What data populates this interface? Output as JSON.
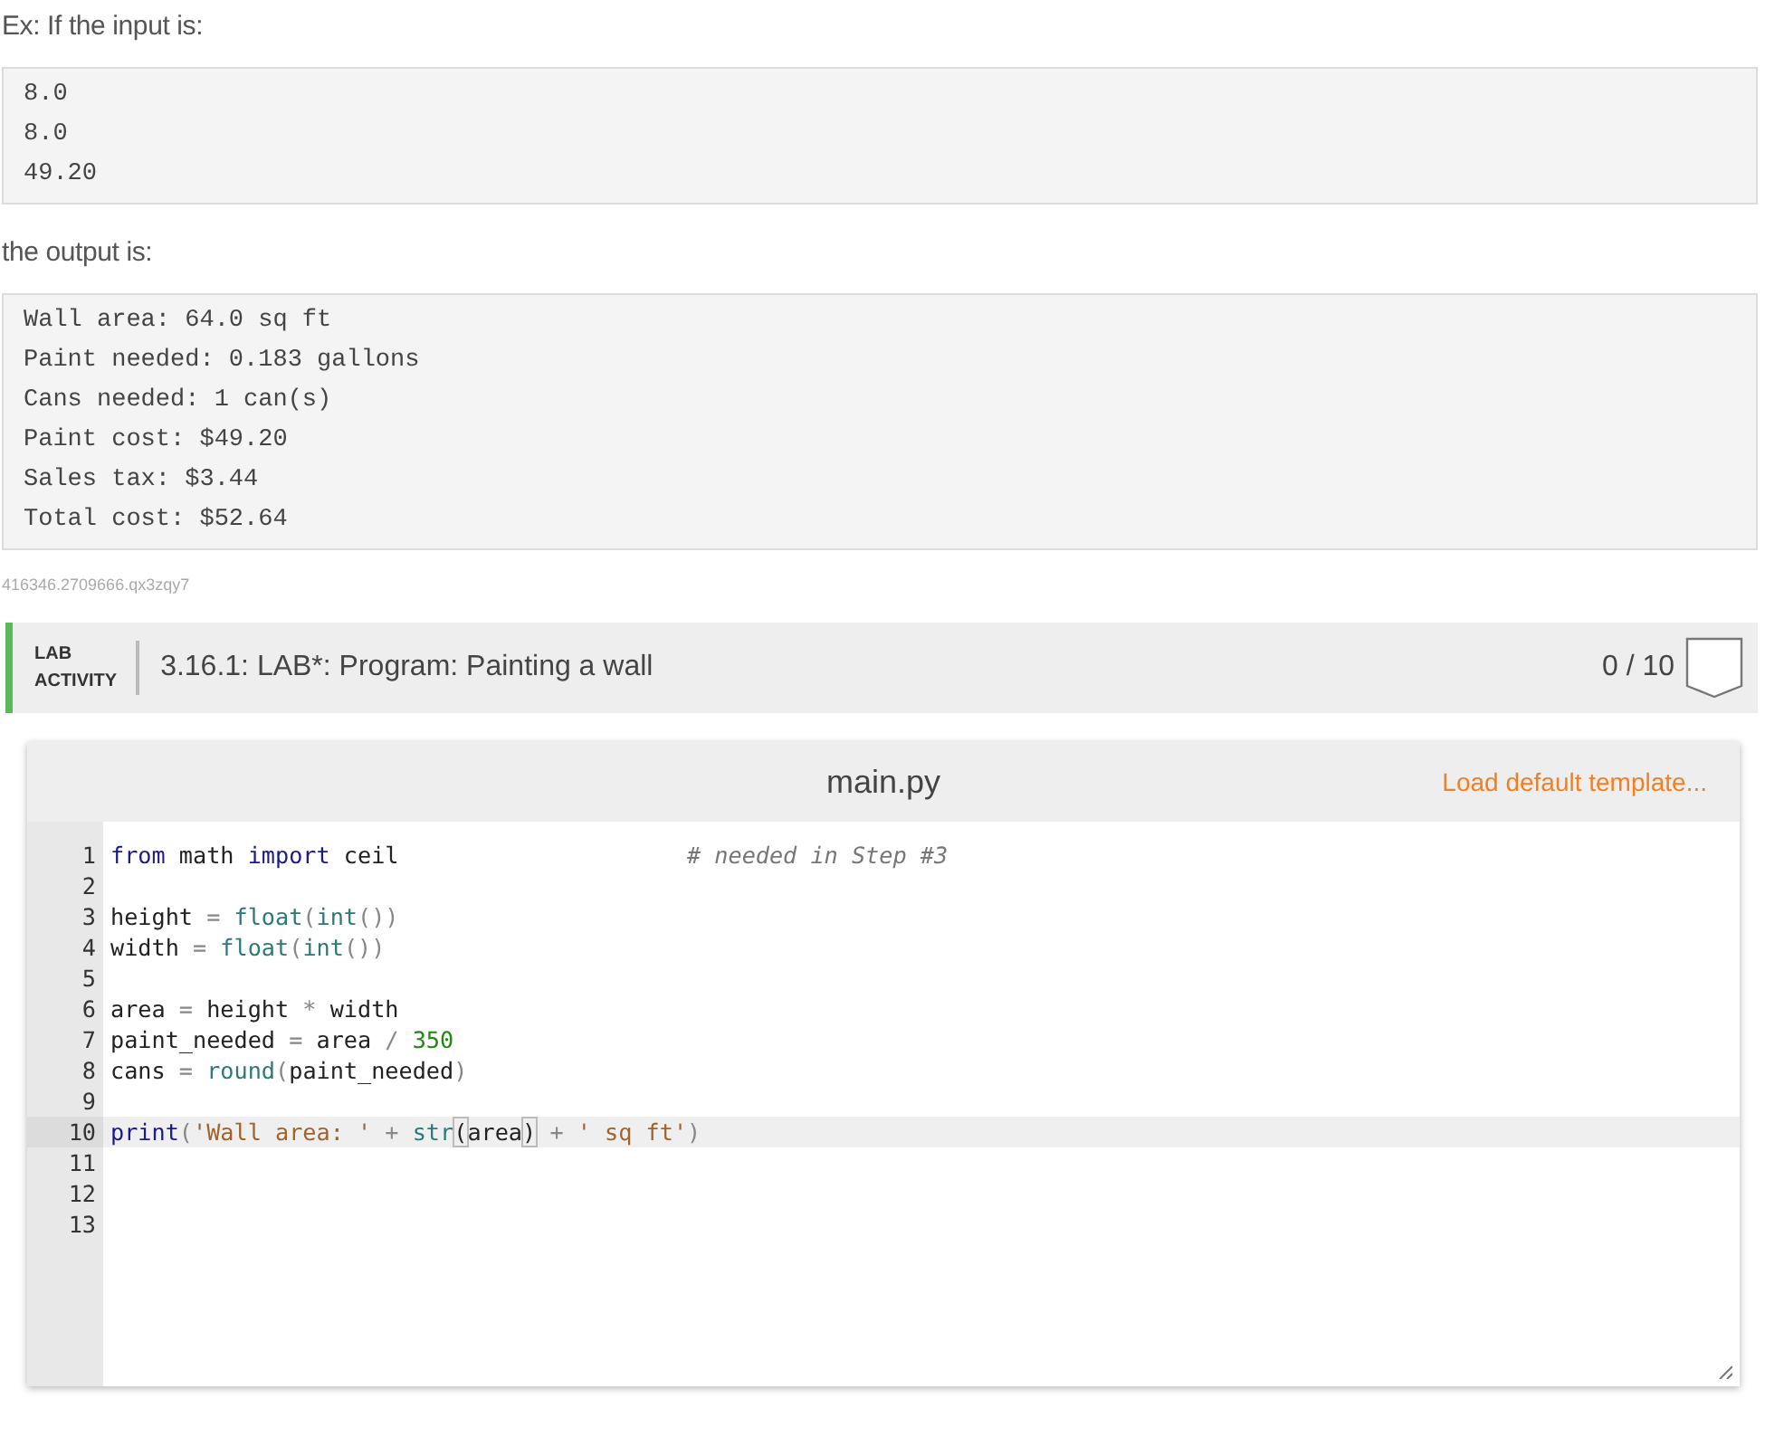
{
  "intro_text": "Ex: If the input is:",
  "input_lines": [
    "8.0",
    "8.0",
    "49.20"
  ],
  "output_intro": "the output is:",
  "output_lines": [
    "Wall area: 64.0 sq ft",
    "Paint needed: 0.183 gallons",
    "Cans needed: 1 can(s)",
    "Paint cost: $49.20",
    "Sales tax: $3.44",
    "Total cost: $52.64"
  ],
  "footnote_id": "416346.2709666.qx3zqy7",
  "lab": {
    "label_line_1": "LAB",
    "label_line_2": "ACTIVITY",
    "title": "3.16.1: LAB*: Program: Painting a wall",
    "score": "0 / 10"
  },
  "editor": {
    "filename": "main.py",
    "template_link": "Load default template...",
    "lines": [
      {
        "number": "1",
        "active": false,
        "tokens": [
          {
            "kind": "keyword",
            "text": "from"
          },
          {
            "kind": "plain",
            "text": " math "
          },
          {
            "kind": "keyword",
            "text": "import"
          },
          {
            "kind": "plain",
            "text": " ceil                     "
          },
          {
            "kind": "comment",
            "text": "# needed in Step #3"
          }
        ]
      },
      {
        "number": "2",
        "active": false
      },
      {
        "number": "3",
        "active": false,
        "tokens": [
          {
            "kind": "plain",
            "text": "height"
          },
          {
            "kind": "operator",
            "text": " = "
          },
          {
            "kind": "builtin",
            "text": "float"
          },
          {
            "kind": "operator",
            "text": "("
          },
          {
            "kind": "builtin",
            "text": "int"
          },
          {
            "kind": "operator",
            "text": "())"
          }
        ]
      },
      {
        "number": "4",
        "active": false,
        "tokens": [
          {
            "kind": "plain",
            "text": "width"
          },
          {
            "kind": "operator",
            "text": " = "
          },
          {
            "kind": "builtin",
            "text": "float"
          },
          {
            "kind": "operator",
            "text": "("
          },
          {
            "kind": "builtin",
            "text": "int"
          },
          {
            "kind": "operator",
            "text": "())"
          }
        ]
      },
      {
        "number": "5",
        "active": false
      },
      {
        "number": "6",
        "active": false,
        "tokens": [
          {
            "kind": "plain",
            "text": "area"
          },
          {
            "kind": "operator",
            "text": " = "
          },
          {
            "kind": "plain",
            "text": "height"
          },
          {
            "kind": "operator",
            "text": " * "
          },
          {
            "kind": "plain",
            "text": "width"
          }
        ]
      },
      {
        "number": "7",
        "active": false,
        "tokens": [
          {
            "kind": "plain",
            "text": "paint_needed"
          },
          {
            "kind": "operator",
            "text": " = "
          },
          {
            "kind": "plain",
            "text": "area"
          },
          {
            "kind": "operator",
            "text": " / "
          },
          {
            "kind": "number",
            "text": "350"
          }
        ]
      },
      {
        "number": "8",
        "active": false,
        "tokens": [
          {
            "kind": "plain",
            "text": "cans"
          },
          {
            "kind": "operator",
            "text": " = "
          },
          {
            "kind": "builtin",
            "text": "round"
          },
          {
            "kind": "operator",
            "text": "("
          },
          {
            "kind": "plain",
            "text": "paint_needed"
          },
          {
            "kind": "operator",
            "text": ")"
          }
        ]
      },
      {
        "number": "9",
        "active": false
      },
      {
        "number": "10",
        "active": true,
        "tokens": [
          {
            "kind": "keyword",
            "text": "print"
          },
          {
            "kind": "operator",
            "text": "("
          },
          {
            "kind": "string",
            "text": "'Wall area: '"
          },
          {
            "kind": "operator",
            "text": " + "
          },
          {
            "kind": "builtin",
            "text": "str"
          },
          {
            "kind": "bracket_match",
            "text": "("
          },
          {
            "kind": "plain",
            "text": "area"
          },
          {
            "kind": "bracket_match",
            "text": ")"
          },
          {
            "kind": "operator",
            "text": " + "
          },
          {
            "kind": "string",
            "text": "' sq ft'"
          },
          {
            "kind": "operator",
            "text": ")"
          }
        ]
      },
      {
        "number": "11",
        "active": false
      },
      {
        "number": "12",
        "active": false
      },
      {
        "number": "13",
        "active": false
      }
    ]
  }
}
